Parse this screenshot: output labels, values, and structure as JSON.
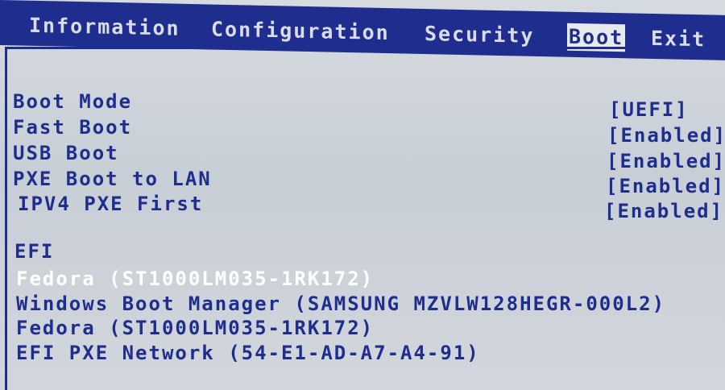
{
  "menu": {
    "tabs": [
      "Information",
      "Configuration",
      "Security",
      "Boot",
      "Exit"
    ],
    "active_tab": "Boot"
  },
  "settings": [
    {
      "label": "Boot Mode",
      "value": "[UEFI]"
    },
    {
      "label": "Fast Boot",
      "value": "[Enabled]"
    },
    {
      "label": "USB Boot",
      "value": "[Enabled]"
    },
    {
      "label": "PXE Boot to LAN",
      "value": "[Enabled]"
    },
    {
      "label": "IPV4 PXE First",
      "value": "[Enabled]"
    }
  ],
  "efi": {
    "heading": "EFI",
    "entries": [
      "Fedora (ST1000LM035-1RK172)",
      "Windows Boot Manager (SAMSUNG MZVLW128HEGR-000L2)",
      "Fedora (ST1000LM035-1RK172)",
      "EFI PXE Network (54-E1-AD-A7-A4-91)"
    ],
    "selected_index": 0
  },
  "colors": {
    "menu_bg": "#1f2e8e",
    "text": "#1f2e8e",
    "highlight_text": "#ffffff",
    "background": "#d0d5db"
  }
}
